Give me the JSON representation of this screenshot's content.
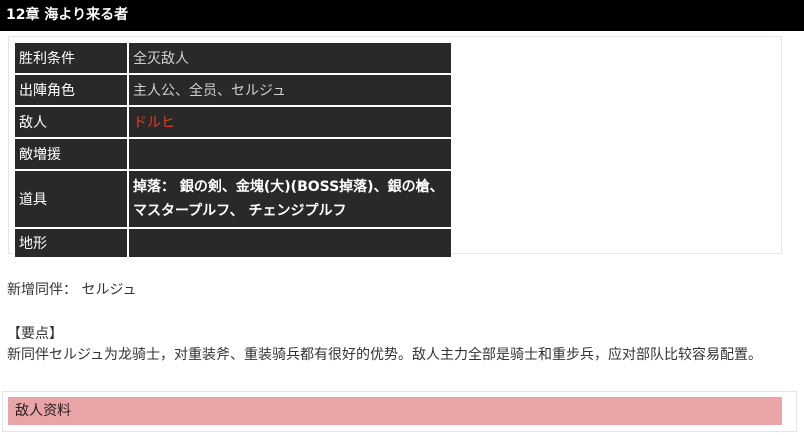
{
  "chapter_title": "12章 海より来る者",
  "info_table": {
    "rows": [
      {
        "label": "胜利条件",
        "value": "全灭敌人"
      },
      {
        "label": "出陣角色",
        "value": "主人公、全员、セルジュ"
      },
      {
        "label": "敌人",
        "value": "ドルヒ"
      },
      {
        "label": "敵増援",
        "value": ""
      },
      {
        "label": "道具",
        "value": "掉落： 銀の剣、金塊(大)(BOSS掉落)、銀の槍、マスタープルフ、 チェンジプルフ"
      },
      {
        "label": "地形",
        "value": ""
      }
    ]
  },
  "new_companion": "新增同伴： セルジュ",
  "key_points": {
    "title": "【要点】",
    "body": "新同伴セルジュ为龙骑士，对重装斧、重装骑兵都有很好的优势。敌人主力全部是骑士和重步兵，应对部队比较容易配置。"
  },
  "enemy_section_title": "敌人资料",
  "colors": {
    "title_bar": "#000000",
    "table_bg": "#292929",
    "enemy_name": "#e83a22",
    "enemy_header_bg": "#e8a4a6"
  }
}
